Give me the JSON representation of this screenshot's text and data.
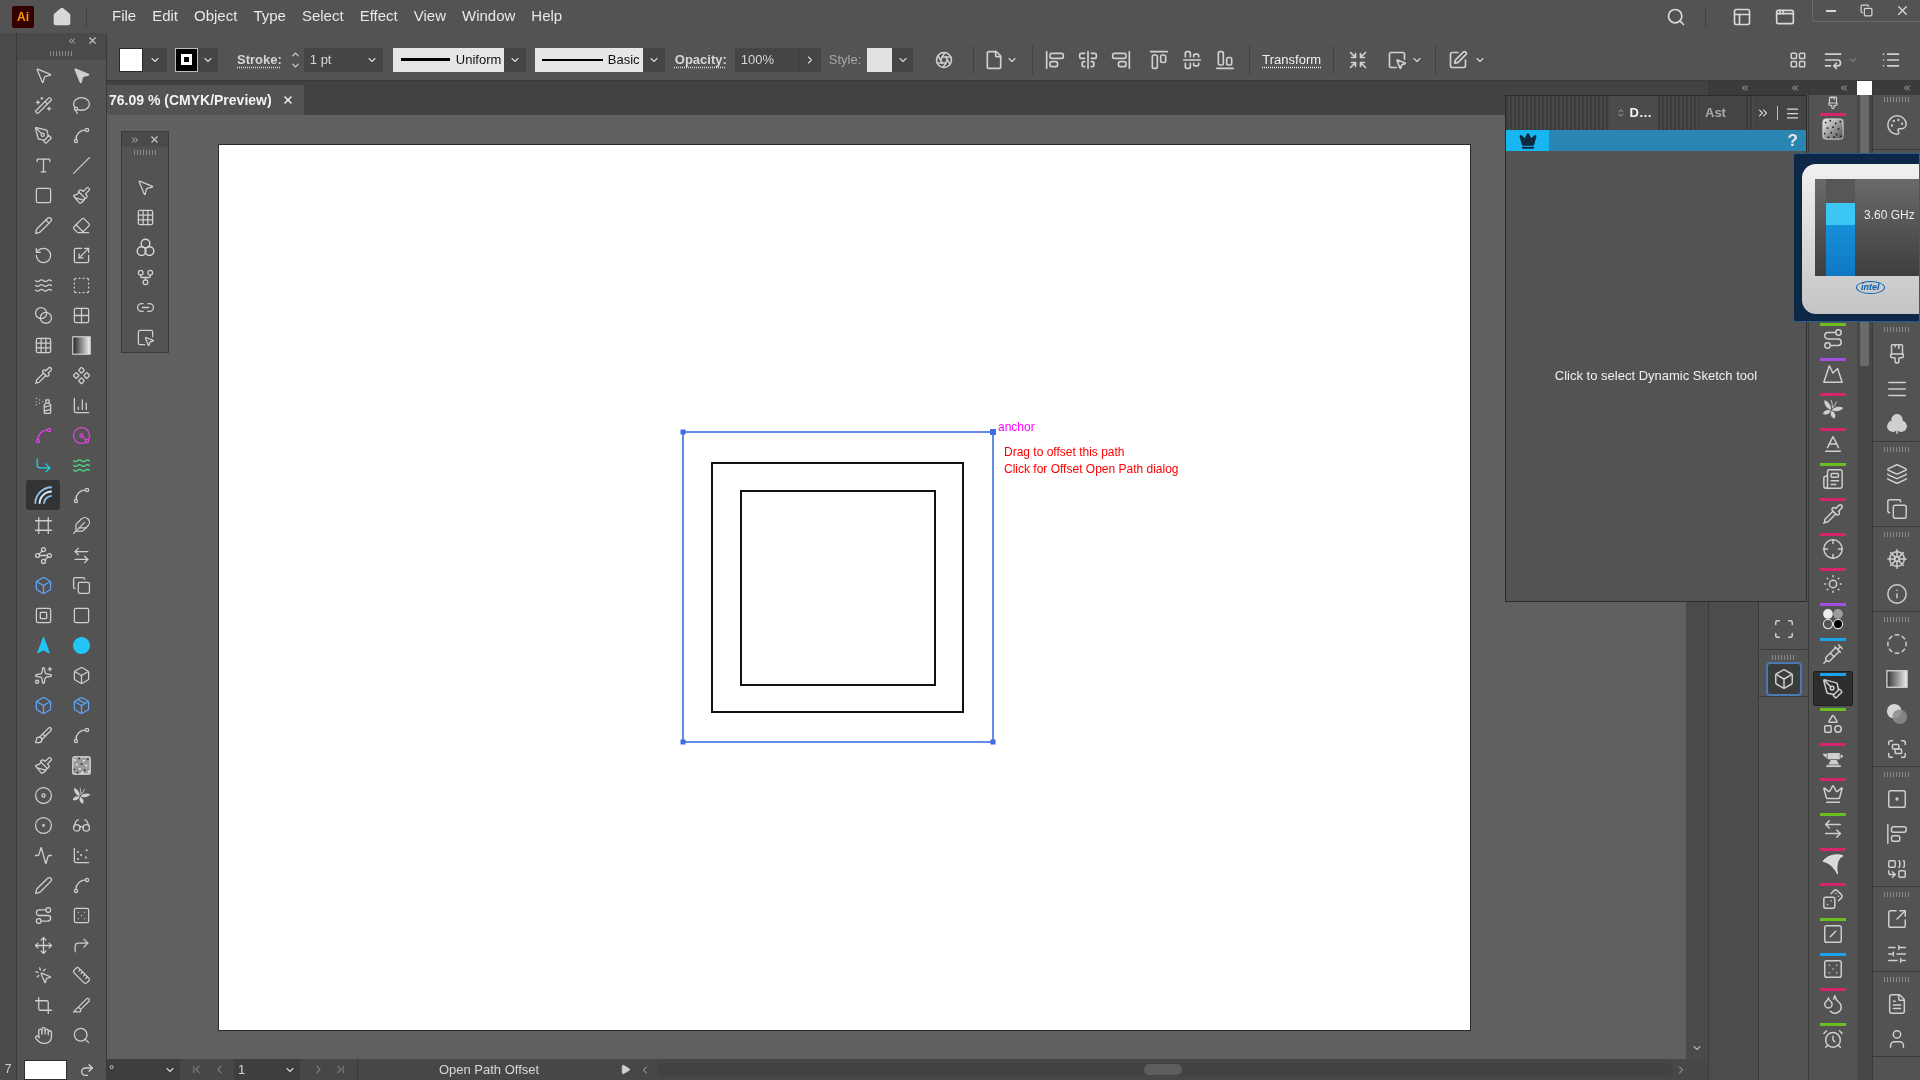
{
  "app_logo": "Ai",
  "menu_bar": {
    "items": [
      "File",
      "Edit",
      "Object",
      "Type",
      "Select",
      "Effect",
      "View",
      "Window",
      "Help"
    ]
  },
  "control_bar": {
    "stroke_label": "Stroke:",
    "stroke_weight": "1 pt",
    "profile": "Uniform",
    "brush": "Basic",
    "opacity_label": "Opacity:",
    "opacity": "100%",
    "style_label": "Style:",
    "transform_label": "Transform"
  },
  "tools_panel": {
    "tools": [
      {
        "selected": false
      },
      {
        "selected": false
      },
      {
        "selected": false
      },
      {
        "selected": false
      },
      {
        "selected": false
      },
      {
        "selected": false
      },
      {
        "selected": false
      },
      {
        "selected": false
      },
      {
        "selected": false
      },
      {
        "selected": false
      },
      {
        "selected": false
      },
      {
        "selected": false
      },
      {
        "selected": false
      },
      {
        "selected": false
      },
      {
        "selected": false
      },
      {
        "selected": false
      },
      {
        "selected": false
      },
      {
        "selected": false
      },
      {
        "selected": false
      },
      {
        "selected": false
      },
      {
        "selected": false
      },
      {
        "selected": false
      },
      {
        "selected": false
      },
      {
        "selected": false
      },
      {
        "selected": false
      },
      {
        "selected": false
      },
      {
        "selected": false
      },
      {
        "selected": false
      },
      {
        "selected": true
      },
      {
        "selected": false
      },
      {
        "selected": false
      },
      {
        "selected": false
      },
      {
        "selected": false
      },
      {
        "selected": false
      },
      {
        "selected": false
      },
      {
        "selected": false
      },
      {
        "selected": false
      },
      {
        "selected": false
      },
      {
        "selected": false
      },
      {
        "selected": false
      },
      {
        "selected": false
      },
      {
        "selected": false
      },
      {
        "selected": false
      },
      {
        "selected": false
      },
      {
        "selected": false
      },
      {
        "selected": false
      },
      {
        "selected": false
      },
      {
        "selected": false
      },
      {
        "selected": false
      },
      {
        "selected": false
      },
      {
        "selected": false
      },
      {
        "selected": false
      },
      {
        "selected": false
      },
      {
        "selected": false
      },
      {
        "selected": false
      },
      {
        "selected": false
      },
      {
        "selected": false
      },
      {
        "selected": false
      },
      {
        "selected": false
      },
      {
        "selected": false
      },
      {
        "selected": false
      },
      {
        "selected": false
      },
      {
        "selected": false
      },
      {
        "selected": false
      },
      {
        "selected": false
      },
      {
        "selected": false
      }
    ]
  },
  "document_tab": {
    "title": "76.09 % (CMYK/Preview)"
  },
  "canvas": {
    "anchor_label": "anchor",
    "hint_lines": [
      "Drag to offset this path",
      "Click for Offset Open Path dialog"
    ]
  },
  "floating_panel": {
    "tabs": [
      {
        "label": "D…",
        "selected": true
      },
      {
        "label": "Ast",
        "selected": false
      }
    ],
    "help": "?",
    "message": "Click to select Dynamic Sketch tool"
  },
  "cpu_gadget": {
    "level": 0.75,
    "frequency": "3.60 GHz",
    "logo": "intel"
  },
  "plugin_strip": {
    "items": [
      {
        "color": "#d6246e",
        "selected": false
      },
      {
        "color": "#6abf1f",
        "selected": false
      },
      {
        "color": "#a24ee0",
        "selected": false
      },
      {
        "color": "#d6246e",
        "selected": false
      },
      {
        "color": "#d6246e",
        "selected": false
      },
      {
        "color": "#6abf1f",
        "selected": false
      },
      {
        "color": "#d6246e",
        "selected": false
      },
      {
        "color": "#d6246e",
        "selected": false
      },
      {
        "color": "#d6246e",
        "selected": false
      },
      {
        "color": "#a24ee0",
        "selected": false
      },
      {
        "color": "#1aa3e6",
        "selected": false
      },
      {
        "color": "#1aa3e6",
        "selected": true
      },
      {
        "color": "#6abf1f",
        "selected": false
      },
      {
        "color": "#d6246e",
        "selected": false
      },
      {
        "color": "#d6246e",
        "selected": false
      },
      {
        "color": "#6abf1f",
        "selected": false
      },
      {
        "color": "#d6246e",
        "selected": false
      },
      {
        "color": "#d6246e",
        "selected": false
      },
      {
        "color": "#6abf1f",
        "selected": false
      },
      {
        "color": "#1aa3e6",
        "selected": false
      },
      {
        "color": "#d6246e",
        "selected": false
      },
      {
        "color": "#6abf1f",
        "selected": false
      }
    ]
  },
  "dock_tools": {
    "items": [
      {
        "selected": false
      },
      {
        "selected": true
      }
    ]
  },
  "status_bar": {
    "zoom": "7",
    "rotation": "°",
    "page": "1",
    "current_tool": "Open Path Offset"
  }
}
